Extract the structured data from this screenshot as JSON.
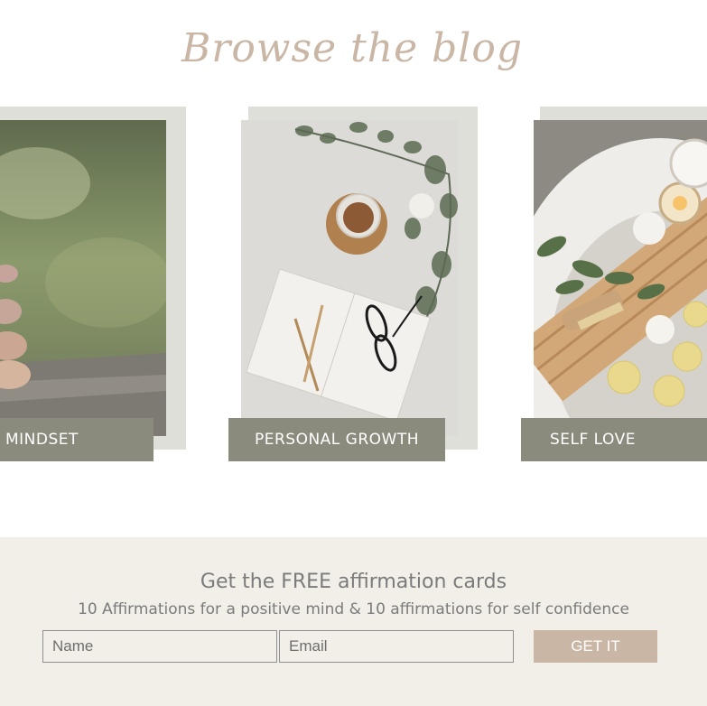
{
  "header": {
    "title": "Browse the blog"
  },
  "categories": [
    {
      "label": "MINDSET",
      "icon": "stacked-stones-photo"
    },
    {
      "label": "PERSONAL GROWTH",
      "icon": "notebook-flatlay-photo"
    },
    {
      "label": "SELF LOVE",
      "icon": "bath-tray-photo"
    }
  ],
  "optin": {
    "title": "Get the FREE affirmation cards",
    "subtitle": "10 Affirmations for a positive mind & 10 affirmations for self confidence",
    "name_placeholder": "Name",
    "email_placeholder": "Email",
    "submit_label": "GET IT"
  },
  "colors": {
    "accent": "#c9b6a5",
    "label_bg": "#8b8b7d",
    "frame": "#dfdfd9",
    "optin_bg": "#f2efe9"
  }
}
